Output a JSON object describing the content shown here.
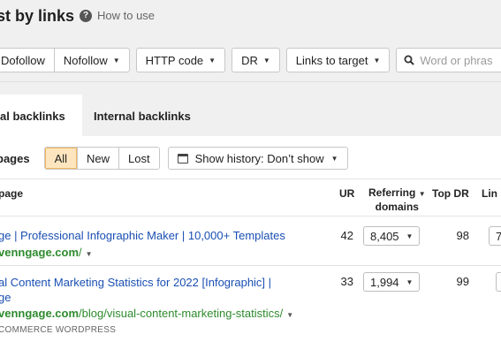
{
  "header": {
    "title": "st by links",
    "how_to": "How to use",
    "how_to_icon": "question-circle-icon"
  },
  "filters": {
    "link_type": [
      "Dofollow",
      "Nofollow"
    ],
    "http_code": "HTTP code",
    "dr": "DR",
    "links_to_target": "Links to target",
    "search_placeholder": "Word or phras",
    "search_icon": "search-icon"
  },
  "tabs": [
    {
      "label": "al backlinks",
      "active": true
    },
    {
      "label": "Internal backlinks",
      "active": false
    }
  ],
  "pages_filter": {
    "label": "pages",
    "options": [
      "All",
      "New",
      "Lost"
    ],
    "selected": "All",
    "history": "Show history: Don’t show",
    "history_icon": "calendar-icon"
  },
  "table": {
    "columns": {
      "page": "page",
      "ur": "UR",
      "referring": "Referring",
      "domains": "domains",
      "top_dr": "Top DR",
      "links": "Lin"
    },
    "rows": [
      {
        "title_lines": [
          "ge | Professional Infographic Maker | 10,000+ Templates"
        ],
        "url_domain": "venngage.com",
        "url_path": "/",
        "ur": "42",
        "referring_domains": "8,405",
        "top_dr": "98",
        "links": "7"
      },
      {
        "title_lines": [
          "al Content Marketing Statistics for 2022 [Infographic] |",
          "ge"
        ],
        "url_domain": "venngage.com",
        "url_path": "/blog/visual-content-marketing-statistics/",
        "ur": "33",
        "referring_domains": "1,994",
        "top_dr": "99",
        "links": "",
        "tags": "COMMERCE   WORDPRESS"
      }
    ]
  },
  "colors": {
    "link": "#1a4fb3",
    "url": "#2e8b2e",
    "selected_segment": "#fde6bf",
    "header_bg": "#f0f0f0"
  }
}
